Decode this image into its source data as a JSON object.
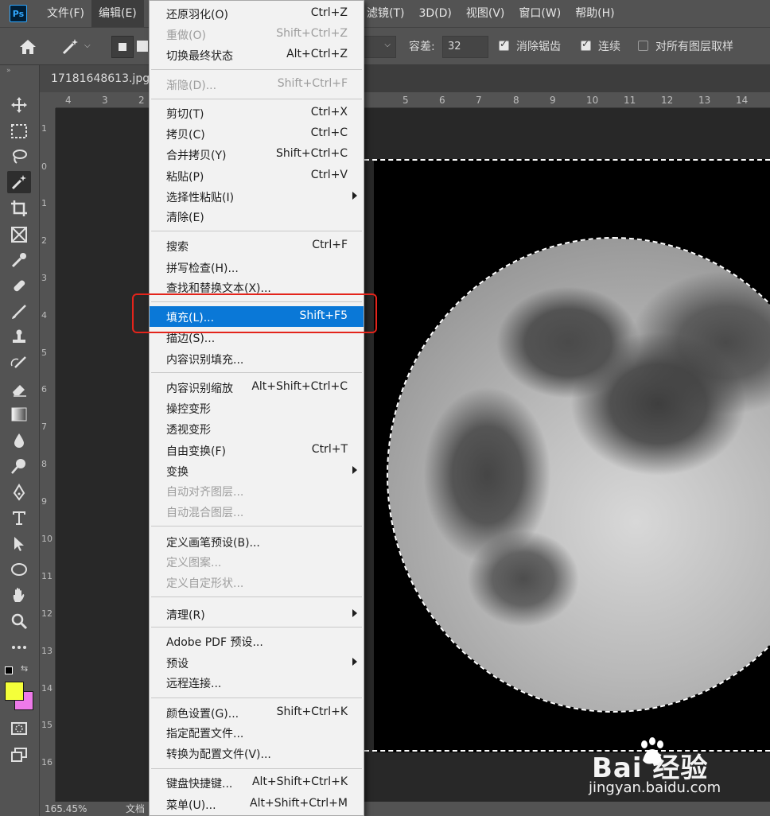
{
  "menubar": {
    "logo": "Ps",
    "left_items": [
      "文件(F)",
      "编辑(E)"
    ],
    "right_items": [
      "滤镜(T)",
      "3D(D)",
      "视图(V)",
      "窗口(W)",
      "帮助(H)"
    ]
  },
  "options": {
    "tolerance_label": "容差:",
    "tolerance_value": "32",
    "antialias_label": "消除锯齿",
    "contiguous_label": "连续",
    "sample_all_label": "对所有图层取样"
  },
  "document": {
    "tab_title": "17181648613.jpg",
    "zoom": "165.45%",
    "status_prefix": "文档"
  },
  "ruler": {
    "top_labels": [
      "4",
      "3",
      "2",
      "5",
      "6",
      "7",
      "8",
      "9",
      "10",
      "11",
      "12",
      "13",
      "14"
    ],
    "left_labels": [
      "1",
      "0",
      "1",
      "2",
      "3",
      "4",
      "5",
      "6",
      "7",
      "8",
      "9",
      "10",
      "11",
      "12",
      "13",
      "14",
      "15",
      "16"
    ]
  },
  "edit_menu": {
    "items": [
      {
        "label": "还原羽化(O)",
        "shortcut": "Ctrl+Z",
        "disabled": false
      },
      {
        "label": "重做(O)",
        "shortcut": "Shift+Ctrl+Z",
        "disabled": true
      },
      {
        "label": "切换最终状态",
        "shortcut": "Alt+Ctrl+Z",
        "disabled": false
      },
      {
        "label": "渐隐(D)...",
        "shortcut": "Shift+Ctrl+F",
        "disabled": true
      },
      {
        "label": "剪切(T)",
        "shortcut": "Ctrl+X",
        "disabled": false
      },
      {
        "label": "拷贝(C)",
        "shortcut": "Ctrl+C",
        "disabled": false
      },
      {
        "label": "合并拷贝(Y)",
        "shortcut": "Shift+Ctrl+C",
        "disabled": false
      },
      {
        "label": "粘贴(P)",
        "shortcut": "Ctrl+V",
        "disabled": false
      },
      {
        "label": "选择性粘贴(I)",
        "shortcut": "",
        "disabled": false
      },
      {
        "label": "清除(E)",
        "shortcut": "",
        "disabled": false
      },
      {
        "label": "搜索",
        "shortcut": "Ctrl+F",
        "disabled": false
      },
      {
        "label": "拼写检查(H)...",
        "shortcut": "",
        "disabled": false
      },
      {
        "label": "查找和替换文本(X)...",
        "shortcut": "",
        "disabled": false
      },
      {
        "label": "填充(L)...",
        "shortcut": "Shift+F5",
        "disabled": false
      },
      {
        "label": "描边(S)...",
        "shortcut": "",
        "disabled": false
      },
      {
        "label": "内容识别填充...",
        "shortcut": "",
        "disabled": false
      },
      {
        "label": "内容识别缩放",
        "shortcut": "Alt+Shift+Ctrl+C",
        "disabled": false
      },
      {
        "label": "操控变形",
        "shortcut": "",
        "disabled": false
      },
      {
        "label": "透视变形",
        "shortcut": "",
        "disabled": false
      },
      {
        "label": "自由变换(F)",
        "shortcut": "Ctrl+T",
        "disabled": false
      },
      {
        "label": "变换",
        "shortcut": "",
        "disabled": false
      },
      {
        "label": "自动对齐图层...",
        "shortcut": "",
        "disabled": true
      },
      {
        "label": "自动混合图层...",
        "shortcut": "",
        "disabled": true
      },
      {
        "label": "定义画笔预设(B)...",
        "shortcut": "",
        "disabled": false
      },
      {
        "label": "定义图案...",
        "shortcut": "",
        "disabled": true
      },
      {
        "label": "定义自定形状...",
        "shortcut": "",
        "disabled": true
      },
      {
        "label": "清理(R)",
        "shortcut": "",
        "disabled": false
      },
      {
        "label": "Adobe PDF 预设...",
        "shortcut": "",
        "disabled": false
      },
      {
        "label": "预设",
        "shortcut": "",
        "disabled": false
      },
      {
        "label": "远程连接...",
        "shortcut": "",
        "disabled": false
      },
      {
        "label": "颜色设置(G)...",
        "shortcut": "Shift+Ctrl+K",
        "disabled": false
      },
      {
        "label": "指定配置文件...",
        "shortcut": "",
        "disabled": false
      },
      {
        "label": "转换为配置文件(V)...",
        "shortcut": "",
        "disabled": false
      },
      {
        "label": "键盘快捷键...",
        "shortcut": "Alt+Shift+Ctrl+K",
        "disabled": false
      },
      {
        "label": "菜单(U)...",
        "shortcut": "Alt+Shift+Ctrl+M",
        "disabled": false
      }
    ]
  },
  "watermark": {
    "main": "Bai 经验",
    "sub": "jingyan.baidu.com"
  },
  "colors": {
    "highlight": "#0a78d7",
    "red_box": "#e3241b",
    "foreground": "#f4ff3a",
    "background": "#ee7ae9"
  }
}
